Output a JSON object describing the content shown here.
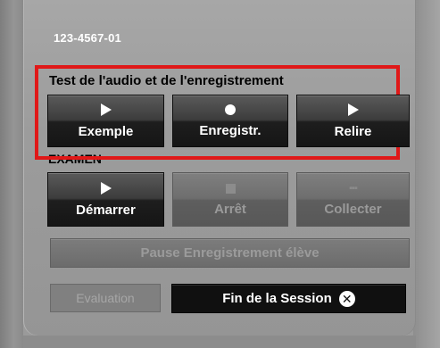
{
  "session": {
    "id": "123-4567-01"
  },
  "audio_test": {
    "title": "Test de l'audio et de l'enregistrement",
    "buttons": [
      {
        "label": "Exemple",
        "icon": "play-icon",
        "enabled": true
      },
      {
        "label": "Enregistr.",
        "icon": "record-icon",
        "enabled": true
      },
      {
        "label": "Relire",
        "icon": "play-icon",
        "enabled": true
      }
    ]
  },
  "exam": {
    "title": "EXAMEN",
    "buttons": [
      {
        "label": "Démarrer",
        "icon": "play-icon",
        "enabled": true
      },
      {
        "label": "Arrêt",
        "icon": "stop-icon",
        "enabled": false
      },
      {
        "label": "Collecter",
        "icon": "collect-icon",
        "enabled": false
      }
    ],
    "pause_label": "Pause Enregistrement élève"
  },
  "footer": {
    "evaluation_label": "Evaluation",
    "end_session_label": "Fin de la Session"
  },
  "colors": {
    "highlight_border": "#e01818",
    "button_dark": "#151515",
    "button_disabled": "#6e6e6e",
    "panel": "#9c9c9c"
  }
}
